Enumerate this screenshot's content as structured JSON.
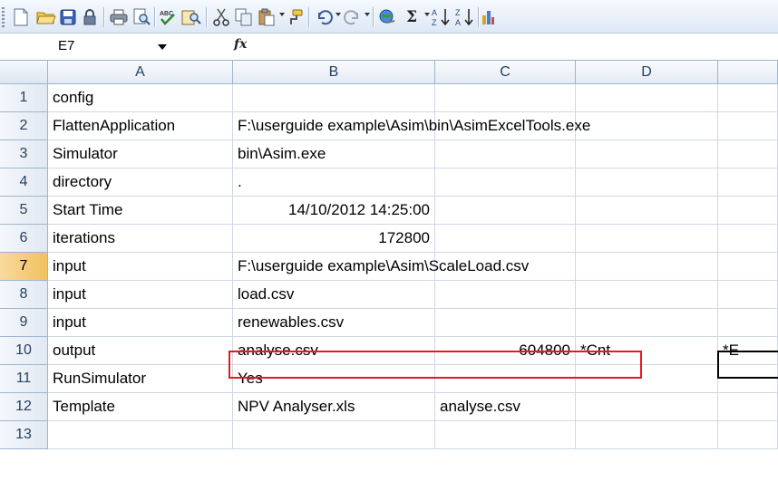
{
  "toolbar": {
    "icons": [
      "new-document-icon",
      "open-folder-icon",
      "save-icon",
      "permission-icon",
      "print-icon",
      "print-preview-icon",
      "spelling-icon",
      "research-icon",
      "cut-icon",
      "copy-icon",
      "paste-icon",
      "format-painter-icon",
      "undo-icon",
      "redo-icon",
      "hyperlink-icon",
      "autosum-icon",
      "sort-ascending-icon",
      "sort-descending-icon",
      "chart-wizard-icon"
    ],
    "autosum_glyph": "Σ"
  },
  "formula_bar": {
    "name_box": "E7",
    "fx_label": "fx",
    "formula": ""
  },
  "sheet": {
    "columns": [
      "A",
      "B",
      "C",
      "D"
    ],
    "active_cell": "E7",
    "rows": [
      {
        "num": "1",
        "a": "config",
        "b": "",
        "c": "",
        "d": "",
        "e": ""
      },
      {
        "num": "2",
        "a": "FlattenApplication",
        "b": "F:\\userguide example\\Asim\\bin\\AsimExcelTools.exe",
        "c": "",
        "d": "",
        "e": ""
      },
      {
        "num": "3",
        "a": "Simulator",
        "b": "bin\\Asim.exe",
        "c": "",
        "d": "",
        "e": ""
      },
      {
        "num": "4",
        "a": "directory",
        "b": ".",
        "c": "",
        "d": "",
        "e": ""
      },
      {
        "num": "5",
        "a": "Start Time",
        "b": "14/10/2012 14:25:00",
        "c": "",
        "d": "",
        "e": ""
      },
      {
        "num": "6",
        "a": "iterations",
        "b": "172800",
        "c": "",
        "d": "",
        "e": ""
      },
      {
        "num": "7",
        "a": "input",
        "b": "F:\\userguide example\\Asim\\ScaleLoad.csv",
        "c": "",
        "d": "",
        "e": ""
      },
      {
        "num": "8",
        "a": "input",
        "b": "load.csv",
        "c": "",
        "d": "",
        "e": ""
      },
      {
        "num": "9",
        "a": "input",
        "b": "renewables.csv",
        "c": "",
        "d": "",
        "e": ""
      },
      {
        "num": "10",
        "a": "output",
        "b": "analyse.csv",
        "c": "604800",
        "d": "*Cnt",
        "e": "*E"
      },
      {
        "num": "11",
        "a": "RunSimulator",
        "b": "Yes",
        "c": "",
        "d": "",
        "e": ""
      },
      {
        "num": "12",
        "a": "Template",
        "b": "NPV Analyser.xls",
        "c": "analyse.csv",
        "d": "",
        "e": ""
      },
      {
        "num": "13",
        "a": "",
        "b": "",
        "c": "",
        "d": "",
        "e": ""
      }
    ]
  },
  "colors": {
    "highlight_border": "#e01b24",
    "active_row_header": "#f1c15f",
    "header_text": "#27415f"
  }
}
